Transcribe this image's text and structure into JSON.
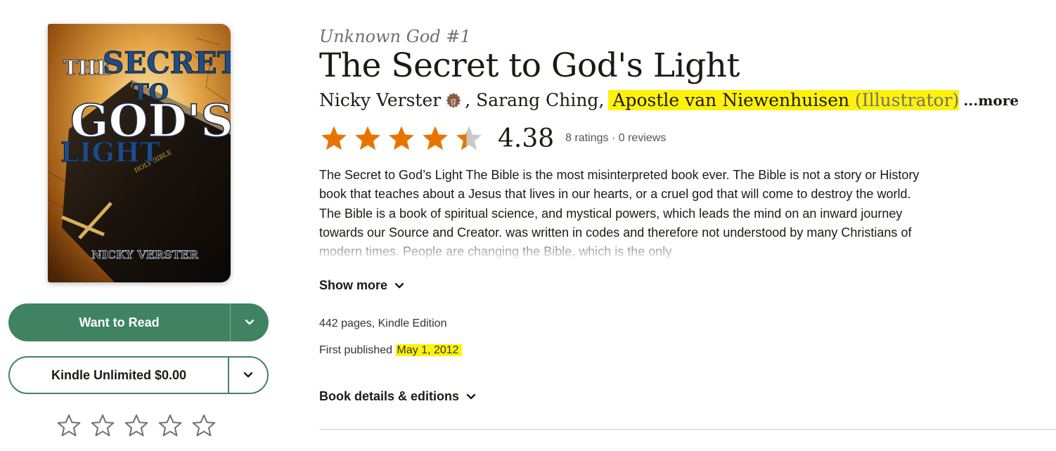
{
  "book": {
    "series": "Unknown God #1",
    "title": "The Secret to God's Light",
    "authors": [
      {
        "name": "Nicky Verster",
        "badge": "goodreads-author-icon"
      },
      {
        "name": "Sarang Ching"
      },
      {
        "name": "Apostle van Niewenhuisen",
        "role": "(Illustrator)"
      }
    ],
    "separator": ",",
    "more_label": "...more",
    "cover": {
      "title_word1": "THE",
      "title_word2": "SECRET",
      "title_word3": "TO",
      "title_word4": "GOD'S",
      "title_word5": "LIGHT",
      "spine_text": "HOLY BIBLE",
      "author_text": "NICKY VERSTER"
    },
    "rating": {
      "average": "4.38",
      "stars_value": 4.38,
      "counts_text": "8 ratings · 0 reviews"
    },
    "description": "The Secret to God’s Light The Bible is the most misinterpreted book ever. The Bible is not a story or History book that teaches about a Jesus that lives in our hearts, or a cruel god that will come to destroy the world. The Bible is a book of spiritual science, and mystical powers, which leads the mind on an inward journey towards our Source and Creator. was written in codes and therefore not understood by many Christians of modern times. People are changing the Bible, which is the only",
    "show_more_label": "Show more",
    "pages_format": "442 pages, Kindle Edition",
    "first_published_label": "First published",
    "first_published_date": "May 1, 2012",
    "details_label": "Book details & editions"
  },
  "actions": {
    "want_to_read": "Want to Read",
    "kindle_unlimited": "Kindle Unlimited $0.00"
  },
  "colors": {
    "primary_green": "#3f8363",
    "star_orange": "#e87400",
    "star_empty": "#c9c9c9",
    "highlight": "#fff20a",
    "badge_brown": "#8c5a45"
  }
}
